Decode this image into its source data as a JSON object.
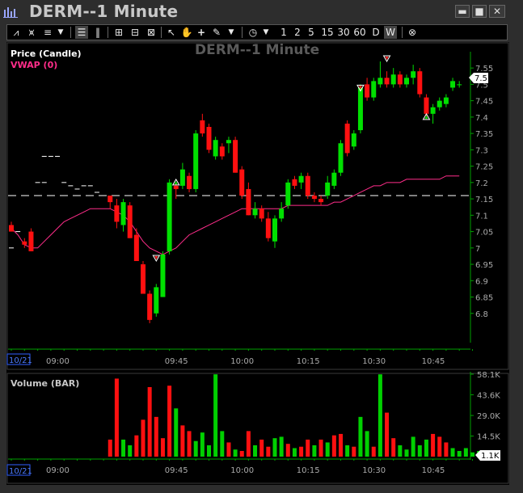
{
  "window": {
    "title": "DERM--1 Minute",
    "buttons": {
      "minimize": "▬",
      "maximize": "■",
      "close": "✕"
    },
    "icon": "bar-chart-icon"
  },
  "toolbar": {
    "intervals": [
      "1",
      "2",
      "5",
      "15",
      "30",
      "60",
      "D",
      "W"
    ]
  },
  "chart_data": [
    {
      "type": "candlestick",
      "watermark": "DERM--1 Minute",
      "legend": [
        {
          "name": "Price (Candle)",
          "color": "#ffffff"
        },
        {
          "name": "VWAP (0)",
          "color": "#ff2d8a"
        }
      ],
      "colors": {
        "up": "#00e000",
        "down": "#ff1010",
        "vwap": "#ff2d8a",
        "axis": "#00b000",
        "reference_line": "#ffffff"
      },
      "ylim": [
        6.75,
        7.58
      ],
      "yticks": [
        "7.55",
        "7.5",
        "7.45",
        "7.4",
        "7.35",
        "7.3",
        "7.25",
        "7.2",
        "7.15",
        "7.1",
        "7.05",
        "7",
        "6.95",
        "6.9",
        "6.85",
        "6.8"
      ],
      "xticks": [
        {
          "label": "09:00",
          "index": 7
        },
        {
          "label": "09:45",
          "index": 25
        },
        {
          "label": "10:00",
          "index": 35
        },
        {
          "label": "10:15",
          "index": 45
        },
        {
          "label": "10:30",
          "index": 55
        },
        {
          "label": "10:45",
          "index": 64
        }
      ],
      "date_label": "10/21",
      "last_price_label": "7.5",
      "reference_price": 7.16,
      "candles": [
        {
          "i": 0,
          "o": 7.07,
          "h": 7.08,
          "l": 7.05,
          "c": 7.05
        },
        {
          "i": 2,
          "o": 7.02,
          "h": 7.03,
          "l": 7.0,
          "c": 7.01
        },
        {
          "i": 3,
          "o": 7.05,
          "h": 7.06,
          "l": 6.99,
          "c": 6.99
        },
        {
          "i": 15,
          "o": 7.16,
          "h": 7.16,
          "l": 7.12,
          "c": 7.14
        },
        {
          "i": 16,
          "o": 7.13,
          "h": 7.15,
          "l": 7.06,
          "c": 7.08
        },
        {
          "i": 17,
          "o": 7.07,
          "h": 7.15,
          "l": 7.05,
          "c": 7.14
        },
        {
          "i": 18,
          "o": 7.13,
          "h": 7.14,
          "l": 7.03,
          "c": 7.03
        },
        {
          "i": 19,
          "o": 7.04,
          "h": 7.06,
          "l": 6.96,
          "c": 6.96
        },
        {
          "i": 20,
          "o": 6.95,
          "h": 6.96,
          "l": 6.86,
          "c": 6.86
        },
        {
          "i": 21,
          "o": 6.86,
          "h": 6.87,
          "l": 6.77,
          "c": 6.78
        },
        {
          "i": 22,
          "o": 6.8,
          "h": 6.89,
          "l": 6.79,
          "c": 6.88
        },
        {
          "i": 23,
          "o": 6.85,
          "h": 6.99,
          "l": 6.85,
          "c": 6.98
        },
        {
          "i": 24,
          "o": 6.99,
          "h": 7.21,
          "l": 6.98,
          "c": 7.2
        },
        {
          "i": 25,
          "o": 7.19,
          "h": 7.2,
          "l": 7.15,
          "c": 7.18
        },
        {
          "i": 26,
          "o": 7.19,
          "h": 7.26,
          "l": 7.18,
          "c": 7.24
        },
        {
          "i": 27,
          "o": 7.22,
          "h": 7.23,
          "l": 7.17,
          "c": 7.18
        },
        {
          "i": 28,
          "o": 7.18,
          "h": 7.36,
          "l": 7.17,
          "c": 7.35
        },
        {
          "i": 29,
          "o": 7.39,
          "h": 7.41,
          "l": 7.34,
          "c": 7.35
        },
        {
          "i": 30,
          "o": 7.37,
          "h": 7.38,
          "l": 7.29,
          "c": 7.3
        },
        {
          "i": 31,
          "o": 7.28,
          "h": 7.34,
          "l": 7.27,
          "c": 7.33
        },
        {
          "i": 32,
          "o": 7.31,
          "h": 7.32,
          "l": 7.27,
          "c": 7.28
        },
        {
          "i": 33,
          "o": 7.32,
          "h": 7.34,
          "l": 7.29,
          "c": 7.33
        },
        {
          "i": 34,
          "o": 7.33,
          "h": 7.34,
          "l": 7.23,
          "c": 7.23
        },
        {
          "i": 35,
          "o": 7.24,
          "h": 7.25,
          "l": 7.15,
          "c": 7.16
        },
        {
          "i": 36,
          "o": 7.18,
          "h": 7.2,
          "l": 7.1,
          "c": 7.1
        },
        {
          "i": 37,
          "o": 7.1,
          "h": 7.14,
          "l": 7.09,
          "c": 7.12
        },
        {
          "i": 38,
          "o": 7.12,
          "h": 7.13,
          "l": 7.08,
          "c": 7.09
        },
        {
          "i": 39,
          "o": 7.09,
          "h": 7.11,
          "l": 7.02,
          "c": 7.03
        },
        {
          "i": 40,
          "o": 7.02,
          "h": 7.1,
          "l": 7.0,
          "c": 7.09
        },
        {
          "i": 41,
          "o": 7.09,
          "h": 7.14,
          "l": 7.08,
          "c": 7.12
        },
        {
          "i": 42,
          "o": 7.13,
          "h": 7.21,
          "l": 7.12,
          "c": 7.2
        },
        {
          "i": 43,
          "o": 7.21,
          "h": 7.22,
          "l": 7.18,
          "c": 7.19
        },
        {
          "i": 44,
          "o": 7.2,
          "h": 7.23,
          "l": 7.18,
          "c": 7.22
        },
        {
          "i": 45,
          "o": 7.22,
          "h": 7.23,
          "l": 7.15,
          "c": 7.16
        },
        {
          "i": 46,
          "o": 7.16,
          "h": 7.17,
          "l": 7.14,
          "c": 7.15
        },
        {
          "i": 47,
          "o": 7.15,
          "h": 7.16,
          "l": 7.13,
          "c": 7.14
        },
        {
          "i": 48,
          "o": 7.16,
          "h": 7.22,
          "l": 7.15,
          "c": 7.2
        },
        {
          "i": 49,
          "o": 7.19,
          "h": 7.24,
          "l": 7.18,
          "c": 7.23
        },
        {
          "i": 50,
          "o": 7.23,
          "h": 7.33,
          "l": 7.22,
          "c": 7.32
        },
        {
          "i": 51,
          "o": 7.38,
          "h": 7.39,
          "l": 7.28,
          "c": 7.29
        },
        {
          "i": 52,
          "o": 7.31,
          "h": 7.36,
          "l": 7.3,
          "c": 7.35
        },
        {
          "i": 53,
          "o": 7.36,
          "h": 7.5,
          "l": 7.35,
          "c": 7.49
        },
        {
          "i": 54,
          "o": 7.5,
          "h": 7.52,
          "l": 7.45,
          "c": 7.46
        },
        {
          "i": 55,
          "o": 7.46,
          "h": 7.52,
          "l": 7.45,
          "c": 7.51
        },
        {
          "i": 56,
          "o": 7.5,
          "h": 7.57,
          "l": 7.49,
          "c": 7.52
        },
        {
          "i": 57,
          "o": 7.52,
          "h": 7.54,
          "l": 7.49,
          "c": 7.5
        },
        {
          "i": 58,
          "o": 7.5,
          "h": 7.55,
          "l": 7.49,
          "c": 7.53
        },
        {
          "i": 59,
          "o": 7.53,
          "h": 7.54,
          "l": 7.49,
          "c": 7.5
        },
        {
          "i": 60,
          "o": 7.5,
          "h": 7.53,
          "l": 7.49,
          "c": 7.52
        },
        {
          "i": 61,
          "o": 7.52,
          "h": 7.56,
          "l": 7.5,
          "c": 7.54
        },
        {
          "i": 62,
          "o": 7.54,
          "h": 7.55,
          "l": 7.46,
          "c": 7.47
        },
        {
          "i": 63,
          "o": 7.46,
          "h": 7.47,
          "l": 7.4,
          "c": 7.41
        },
        {
          "i": 64,
          "o": 7.41,
          "h": 7.44,
          "l": 7.38,
          "c": 7.43
        },
        {
          "i": 65,
          "o": 7.43,
          "h": 7.46,
          "l": 7.42,
          "c": 7.45
        },
        {
          "i": 66,
          "o": 7.44,
          "h": 7.47,
          "l": 7.43,
          "c": 7.46
        },
        {
          "i": 67,
          "o": 7.49,
          "h": 7.52,
          "l": 7.48,
          "c": 7.51
        },
        {
          "i": 68,
          "o": 7.5,
          "h": 7.51,
          "l": 7.49,
          "c": 7.5
        }
      ],
      "prints": [
        {
          "i": 0,
          "p": 7.0
        },
        {
          "i": 1,
          "p": 7.05
        },
        {
          "i": 5,
          "p": 7.28
        },
        {
          "i": 6,
          "p": 7.28
        },
        {
          "i": 7,
          "p": 7.28
        },
        {
          "i": 4,
          "p": 7.2
        },
        {
          "i": 5,
          "p": 7.2
        },
        {
          "i": 8,
          "p": 7.2
        },
        {
          "i": 9,
          "p": 7.19
        },
        {
          "i": 10,
          "p": 7.18
        },
        {
          "i": 11,
          "p": 7.19
        },
        {
          "i": 12,
          "p": 7.19
        },
        {
          "i": 13,
          "p": 7.17
        }
      ],
      "vwap": [
        7.06,
        7.04,
        7.01,
        7.0,
        7.0,
        7.02,
        7.04,
        7.06,
        7.08,
        7.09,
        7.1,
        7.11,
        7.12,
        7.12,
        7.12,
        7.12,
        7.11,
        7.1,
        7.08,
        7.05,
        7.02,
        7.0,
        6.99,
        6.98,
        6.99,
        7.0,
        7.02,
        7.04,
        7.05,
        7.06,
        7.07,
        7.08,
        7.09,
        7.1,
        7.11,
        7.12,
        7.12,
        7.12,
        7.12,
        7.12,
        7.12,
        7.12,
        7.13,
        7.13,
        7.13,
        7.13,
        7.13,
        7.13,
        7.13,
        7.14,
        7.14,
        7.15,
        7.16,
        7.17,
        7.18,
        7.19,
        7.19,
        7.2,
        7.2,
        7.2,
        7.21,
        7.21,
        7.21,
        7.21,
        7.21,
        7.21,
        7.22,
        7.22,
        7.22
      ],
      "markers": [
        {
          "i": 25,
          "p": 7.2,
          "kind": "up",
          "color": "#00e000"
        },
        {
          "i": 22,
          "p": 6.97,
          "kind": "down",
          "color": "#ff2020"
        },
        {
          "i": 53,
          "p": 7.49,
          "kind": "down",
          "color": "#ff2020"
        },
        {
          "i": 57,
          "p": 7.58,
          "kind": "down",
          "color": "#ff2020"
        },
        {
          "i": 63,
          "p": 7.4,
          "kind": "up",
          "color": "#00e000"
        }
      ]
    },
    {
      "type": "bar",
      "legend": [
        {
          "name": "Volume (BAR)",
          "color": "#ffffff"
        }
      ],
      "ylim": [
        0,
        58100
      ],
      "yticks": [
        "58.1K",
        "43.6K",
        "29.0K",
        "14.5K"
      ],
      "last_value_label": "1.1K",
      "date_label": "10/21",
      "volumes": [
        {
          "i": 15,
          "v": 12000,
          "up": false
        },
        {
          "i": 16,
          "v": 55000,
          "up": false
        },
        {
          "i": 17,
          "v": 12000,
          "up": true
        },
        {
          "i": 18,
          "v": 8000,
          "up": true
        },
        {
          "i": 19,
          "v": 15000,
          "up": false
        },
        {
          "i": 20,
          "v": 26000,
          "up": false
        },
        {
          "i": 21,
          "v": 49000,
          "up": false
        },
        {
          "i": 22,
          "v": 28000,
          "up": false
        },
        {
          "i": 23,
          "v": 13000,
          "up": false
        },
        {
          "i": 24,
          "v": 50000,
          "up": false
        },
        {
          "i": 25,
          "v": 34000,
          "up": true
        },
        {
          "i": 26,
          "v": 22000,
          "up": false
        },
        {
          "i": 27,
          "v": 18000,
          "up": false
        },
        {
          "i": 28,
          "v": 11000,
          "up": true
        },
        {
          "i": 29,
          "v": 17000,
          "up": true
        },
        {
          "i": 30,
          "v": 8000,
          "up": true
        },
        {
          "i": 31,
          "v": 58000,
          "up": true
        },
        {
          "i": 32,
          "v": 18000,
          "up": true
        },
        {
          "i": 33,
          "v": 10000,
          "up": false
        },
        {
          "i": 34,
          "v": 5000,
          "up": true
        },
        {
          "i": 35,
          "v": 4000,
          "up": false
        },
        {
          "i": 36,
          "v": 18000,
          "up": false
        },
        {
          "i": 37,
          "v": 8000,
          "up": true
        },
        {
          "i": 38,
          "v": 12000,
          "up": false
        },
        {
          "i": 39,
          "v": 7000,
          "up": false
        },
        {
          "i": 40,
          "v": 13000,
          "up": true
        },
        {
          "i": 41,
          "v": 14000,
          "up": true
        },
        {
          "i": 42,
          "v": 9000,
          "up": false
        },
        {
          "i": 43,
          "v": 6000,
          "up": true
        },
        {
          "i": 44,
          "v": 7000,
          "up": false
        },
        {
          "i": 45,
          "v": 12000,
          "up": false
        },
        {
          "i": 46,
          "v": 8000,
          "up": true
        },
        {
          "i": 47,
          "v": 12000,
          "up": false
        },
        {
          "i": 48,
          "v": 10000,
          "up": true
        },
        {
          "i": 49,
          "v": 15000,
          "up": false
        },
        {
          "i": 50,
          "v": 16000,
          "up": false
        },
        {
          "i": 51,
          "v": 8000,
          "up": true
        },
        {
          "i": 52,
          "v": 7000,
          "up": false
        },
        {
          "i": 53,
          "v": 28000,
          "up": true
        },
        {
          "i": 54,
          "v": 18000,
          "up": true
        },
        {
          "i": 55,
          "v": 7000,
          "up": false
        },
        {
          "i": 56,
          "v": 58000,
          "up": true
        },
        {
          "i": 57,
          "v": 31000,
          "up": false
        },
        {
          "i": 58,
          "v": 13000,
          "up": false
        },
        {
          "i": 59,
          "v": 8000,
          "up": true
        },
        {
          "i": 60,
          "v": 5000,
          "up": true
        },
        {
          "i": 61,
          "v": 14000,
          "up": true
        },
        {
          "i": 62,
          "v": 8000,
          "up": true
        },
        {
          "i": 63,
          "v": 12000,
          "up": true
        },
        {
          "i": 64,
          "v": 16000,
          "up": false
        },
        {
          "i": 65,
          "v": 14000,
          "up": false
        },
        {
          "i": 66,
          "v": 10000,
          "up": false
        },
        {
          "i": 67,
          "v": 6000,
          "up": true
        },
        {
          "i": 68,
          "v": 4000,
          "up": true
        },
        {
          "i": 69,
          "v": 6000,
          "up": true
        },
        {
          "i": 70,
          "v": 3000,
          "up": true
        },
        {
          "i": 71,
          "v": 4000,
          "up": true
        }
      ]
    }
  ]
}
